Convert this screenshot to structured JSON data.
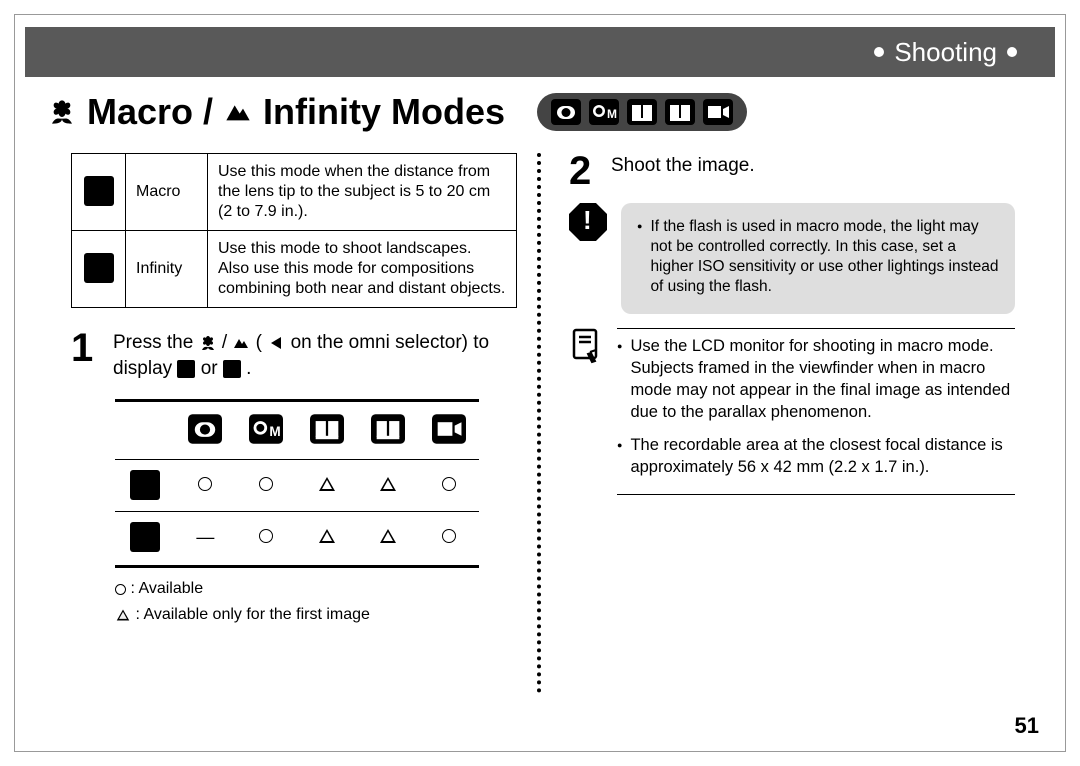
{
  "header": {
    "section": "Shooting"
  },
  "title": {
    "part1": "Macro",
    "slash": "/",
    "part2": "Infinity Modes"
  },
  "definitions": {
    "rows": [
      {
        "name": "Macro",
        "desc": "Use this mode when the distance from the lens tip to the subject is 5 to 20 cm (2 to 7.9 in.)."
      },
      {
        "name": "Infinity",
        "desc": "Use this mode to shoot landscapes. Also use this mode for compositions combining both near and distant objects."
      }
    ]
  },
  "step1": {
    "pre": "Press the ",
    "mid1": " / ",
    "mid2": " (",
    "mid3": " on the omni selector) to display ",
    "mid4": " or ",
    "end": "."
  },
  "matrix": {
    "rows": [
      {
        "label": "macro",
        "cells": [
          "circle",
          "circle",
          "triangle",
          "triangle",
          "circle"
        ]
      },
      {
        "label": "infinity",
        "cells": [
          "dash",
          "circle",
          "triangle",
          "triangle",
          "circle"
        ]
      }
    ]
  },
  "legend": {
    "circle": ": Available",
    "triangle": ": Available only for the first image"
  },
  "step2": {
    "text": "Shoot the image."
  },
  "warning": {
    "text": "If the flash is used in macro mode, the light may not be controlled correctly. In this case, set a higher ISO sensitivity or use other lightings instead of using the flash."
  },
  "info": {
    "items": [
      "Use the LCD monitor for shooting in macro mode. Subjects framed in the viewfinder when in macro mode may not appear in the final image as intended due to the parallax phenomenon.",
      "The recordable area at the closest focal distance is approximately 56 x 42 mm (2.2 x 1.7 in.)."
    ]
  },
  "page_number": "51"
}
